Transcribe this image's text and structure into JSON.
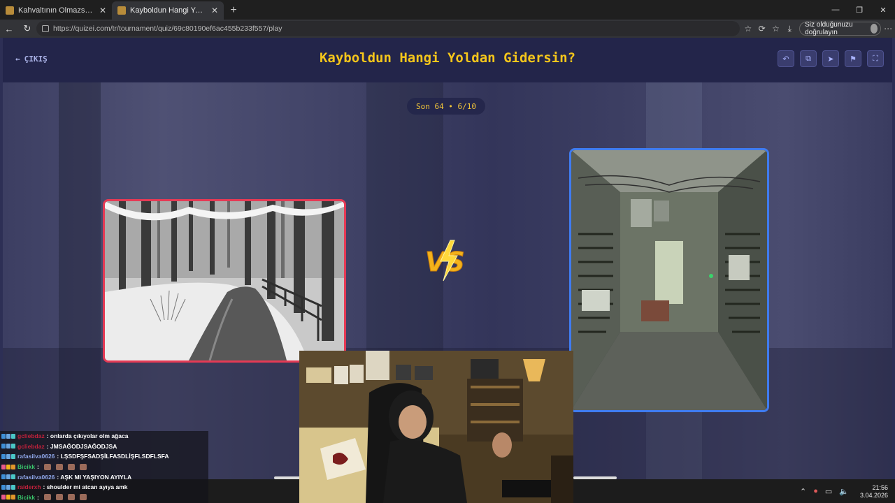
{
  "browser": {
    "tabs": [
      {
        "label": "Kahvaltının Olmazsa Olmazı - Tier"
      },
      {
        "label": "Kayboldun Hangi Yoldan Gidersin?"
      }
    ],
    "url": "https://quizei.com/tr/tournament/quiz/69c80190ef6ac455b233f557/play",
    "verify_label": "Siz olduğunuzu doğrulayın"
  },
  "site": {
    "exit_label": "ÇIKIŞ",
    "title": "Kayboldun Hangi Yoldan Gidersin?",
    "round_label": "Son 64 • 6/10",
    "vs_label": "VS",
    "colors": {
      "title": "#f5c61b",
      "left_border": "#e53a55",
      "right_border": "#3f7cf0"
    },
    "header_icons": [
      "undo-icon",
      "share-icon",
      "send-icon",
      "flag-icon",
      "fullscreen-icon"
    ]
  },
  "chat": {
    "messages": [
      {
        "user": "gcliebdaz",
        "user_color": "#c0213b",
        "text": ": onlarda çıkıyolar olm ağaca"
      },
      {
        "user": "gcliebdaz",
        "user_color": "#c0213b",
        "text": ": JMSAĞODJSAĞODJSA"
      },
      {
        "user": "rafasilva0626",
        "user_color": "#8ea6e8",
        "text": ": LŞSDFŞFSADŞİLFASDLİŞFLSDFLSFA"
      },
      {
        "user": "Bicikk",
        "user_color": "#39c46b",
        "text": ":"
      },
      {
        "user": "rafasilva0626",
        "user_color": "#8ea6e8",
        "text": ": AŞK MI YAŞIYON AYIYLA"
      },
      {
        "user": "raiderxh",
        "user_color": "#c0213b",
        "text": ": shoulder mi atcan ayıya amk"
      },
      {
        "user": "Bicikk",
        "user_color": "#39c46b",
        "text": ":"
      }
    ]
  },
  "taskbar": {
    "time": "21:56",
    "date": "3.04.2026"
  }
}
